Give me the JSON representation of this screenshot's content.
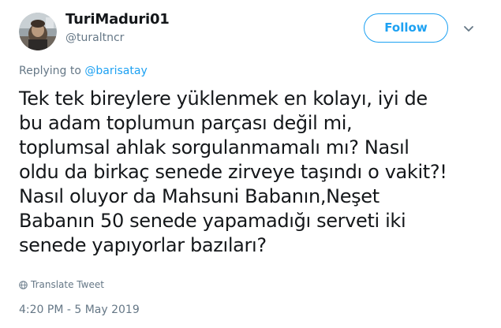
{
  "author": {
    "display_name": "TuriMaduri01",
    "handle": "@turaltncr"
  },
  "header": {
    "follow_label": "Follow",
    "more_icon": "chevron-down-icon"
  },
  "reply": {
    "prefix": "Replying to ",
    "mention": "@barisatay"
  },
  "tweet": {
    "lines": [
      "Tek tek bireylere yüklenmek en kolayı, iyi de",
      "bu adam toplumun parçası değil mi,",
      "toplumsal ahlak sorgulanmamalı mı? Nasıl",
      "oldu da birkaç senede zirveye taşındı o vakit?!",
      "Nasıl oluyor da Mahsuni Babanın,Neşet",
      "Babanın 50 senede yapamadığı serveti iki",
      "senede yapıyorlar bazıları?"
    ]
  },
  "translate": {
    "label": "Translate Tweet",
    "icon": "globe-icon"
  },
  "meta": {
    "timestamp": "4:20 PM - 5 May 2019"
  },
  "colors": {
    "accent": "#1da1f2",
    "secondary_text": "#657786",
    "primary_text": "#14171a"
  }
}
